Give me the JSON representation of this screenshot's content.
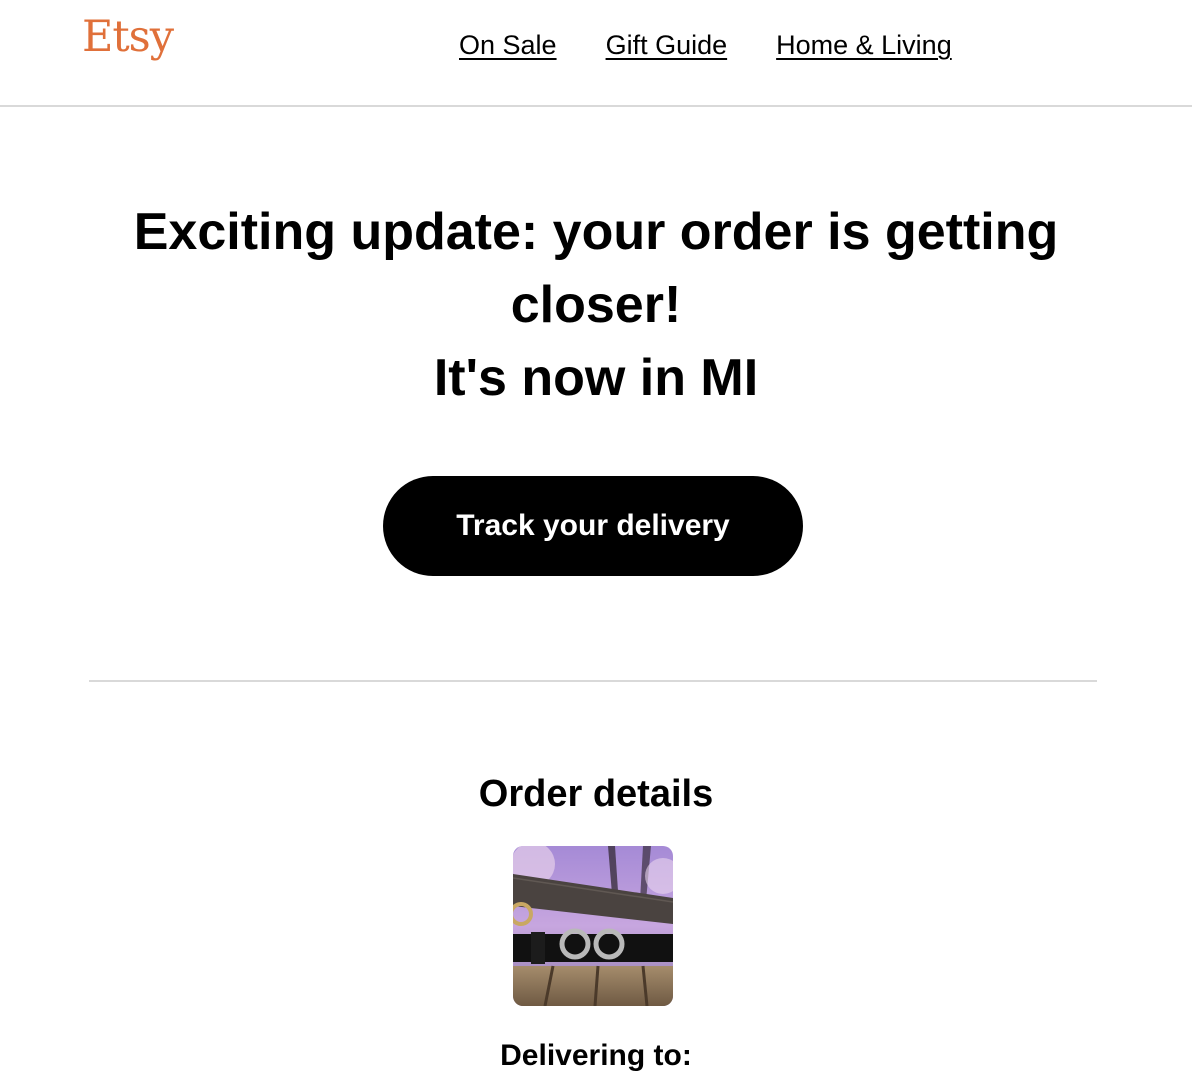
{
  "brand": {
    "logo_text": "Etsy",
    "color": "#e0703a"
  },
  "nav": {
    "items": [
      {
        "label": "On Sale"
      },
      {
        "label": "Gift Guide"
      },
      {
        "label": "Home & Living"
      }
    ]
  },
  "headline": {
    "line1": "Exciting update: your order is getting",
    "line2": "closer!",
    "line3": "It's now in MI"
  },
  "cta": {
    "label": "Track your delivery"
  },
  "order": {
    "title": "Order details",
    "product_image": "leather-collar-product-photo",
    "delivering_label": "Delivering to:"
  }
}
